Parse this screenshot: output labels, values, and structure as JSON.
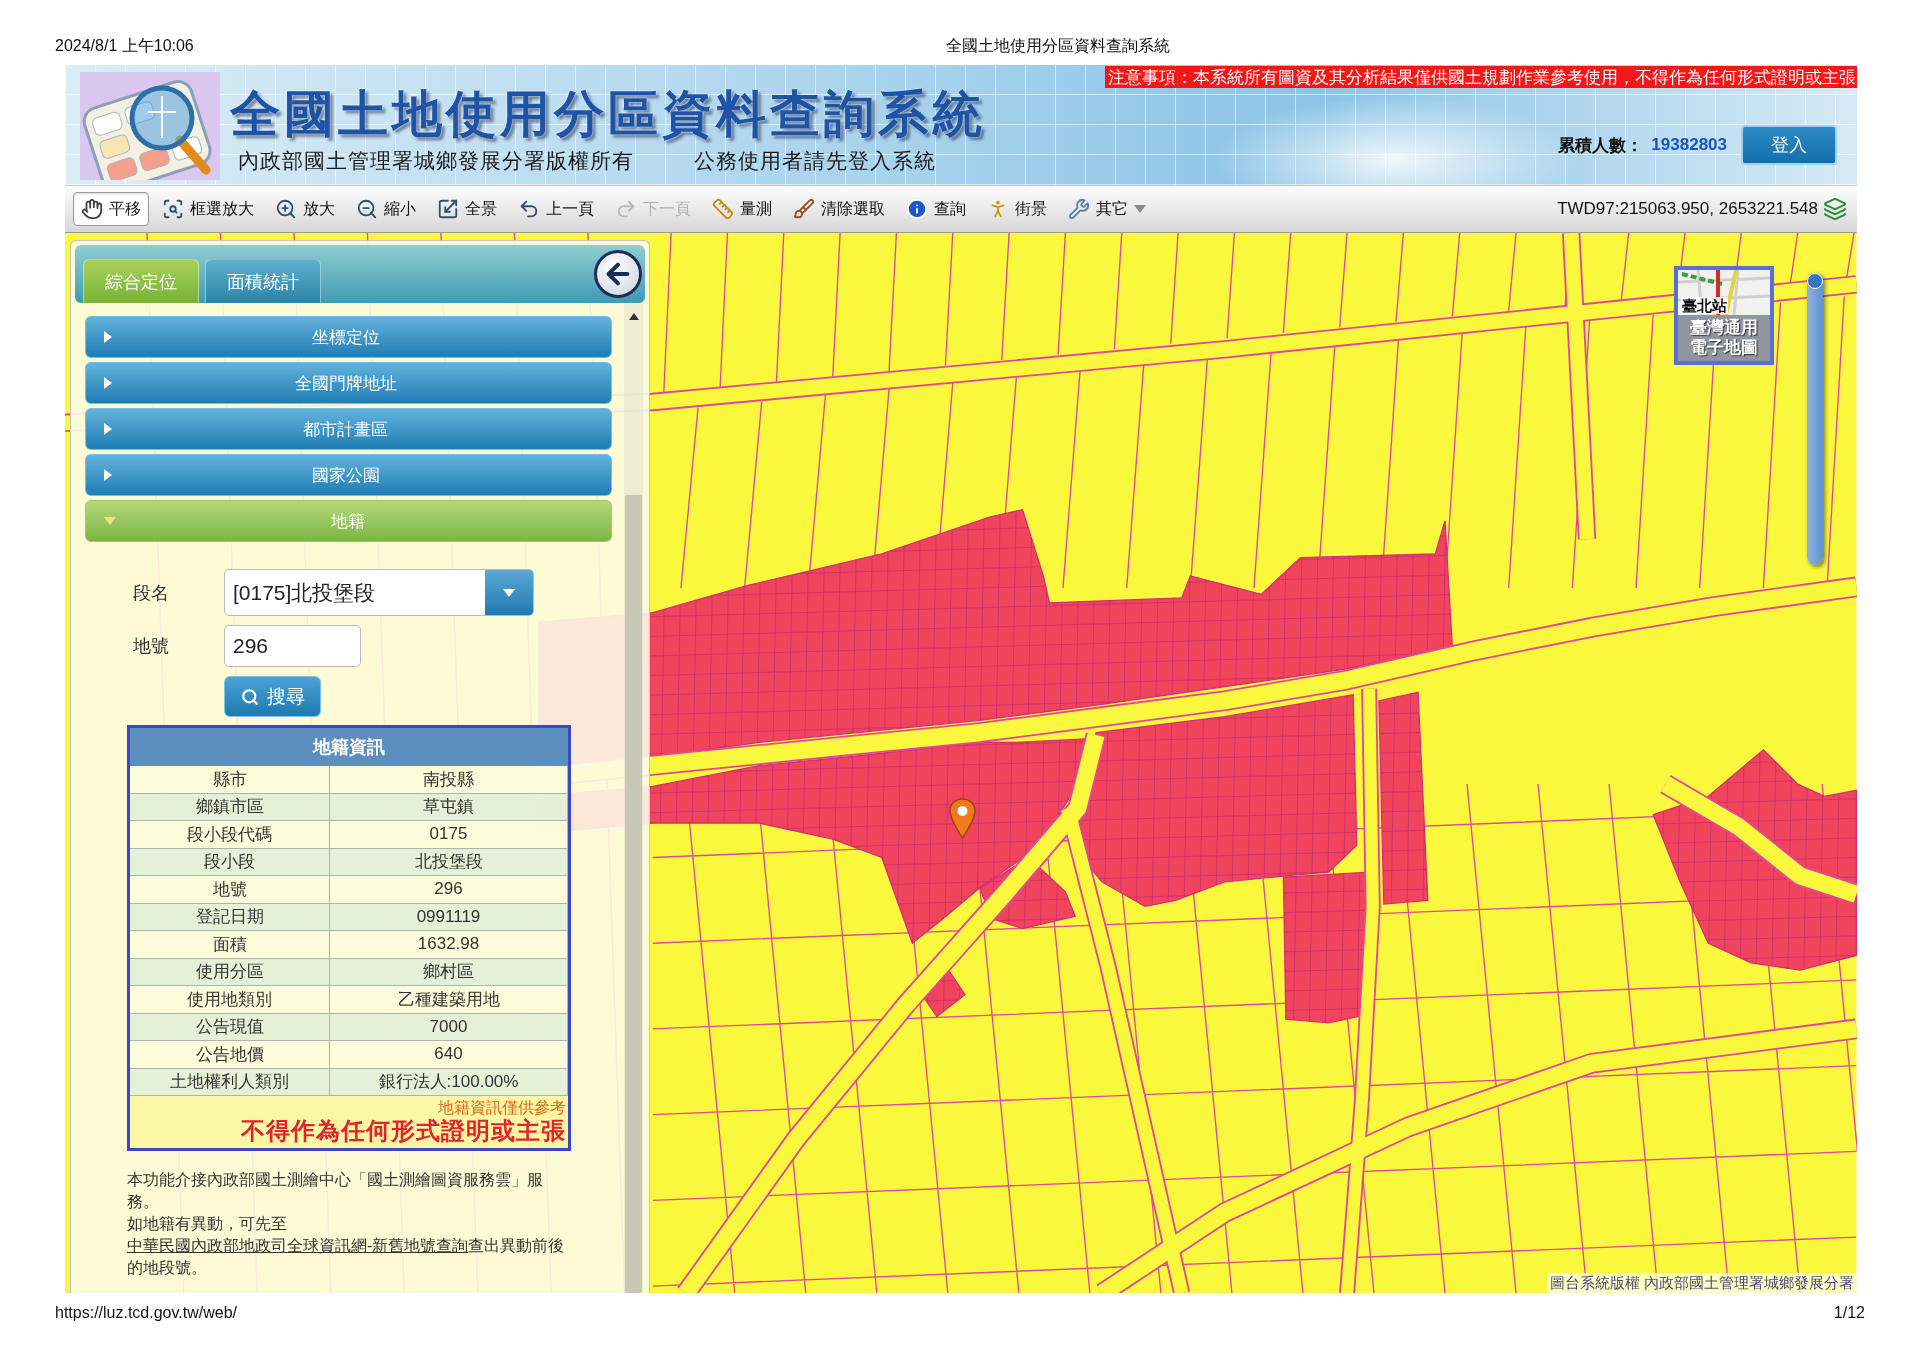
{
  "print_header": {
    "datetime": "2024/8/1 上午10:06",
    "title": "全國土地使用分區資料查詢系統"
  },
  "banner": {
    "title": "全國土地使用分區資料查詢系統",
    "copyright": "內政部國土管理署城鄉發展分署版權所有",
    "login_hint": "公務使用者請先登入系統",
    "notice": "注意事項：本系統所有圖資及其分析結果僅供國土規劃作業參考使用，不得作為任何形式證明或主張",
    "visitor_label": "累積人數：",
    "visitor_count": "19382803",
    "login_button": "登入"
  },
  "toolbar": {
    "tools": [
      {
        "label": "平移",
        "selected": true,
        "disabled": false,
        "kind": "tool"
      },
      {
        "label": "框選放大",
        "selected": false,
        "disabled": false,
        "kind": "tool"
      },
      {
        "label": "放大",
        "selected": false,
        "disabled": false,
        "kind": "tool"
      },
      {
        "label": "縮小",
        "selected": false,
        "disabled": false,
        "kind": "tool"
      },
      {
        "label": "全景",
        "selected": false,
        "disabled": false,
        "kind": "tool"
      },
      {
        "label": "上一頁",
        "selected": false,
        "disabled": false,
        "kind": "tool"
      },
      {
        "label": "下一頁",
        "selected": false,
        "disabled": true,
        "kind": "tool"
      },
      {
        "label": "量測",
        "selected": false,
        "disabled": false,
        "kind": "tool"
      },
      {
        "label": "清除選取",
        "selected": false,
        "disabled": false,
        "kind": "tool"
      },
      {
        "label": "查詢",
        "selected": false,
        "disabled": false,
        "kind": "tool"
      },
      {
        "label": "街景",
        "selected": false,
        "disabled": false,
        "kind": "tool"
      },
      {
        "label": "其它",
        "selected": false,
        "disabled": false,
        "kind": "menu"
      }
    ],
    "coordinates": "TWD97:215063.950, 2653221.548"
  },
  "side_panel": {
    "tabs": [
      {
        "label": "綜合定位",
        "selected": true
      },
      {
        "label": "面積統計",
        "selected": false
      }
    ],
    "sections": [
      {
        "label": "坐標定位",
        "expanded": false
      },
      {
        "label": "全國門牌地址",
        "expanded": false
      },
      {
        "label": "都市計畫區",
        "expanded": false
      },
      {
        "label": "國家公園",
        "expanded": false
      },
      {
        "label": "地籍",
        "expanded": true
      }
    ],
    "form": {
      "fields": [
        {
          "label": "段名",
          "kind": "select",
          "value": "[0175]北投堡段"
        },
        {
          "label": "地號",
          "kind": "input",
          "value": "296"
        }
      ],
      "search_button": "搜尋"
    },
    "info_table": {
      "title": "地籍資訊",
      "rows": [
        {
          "label": "縣市",
          "value": "南投縣"
        },
        {
          "label": "鄉鎮市區",
          "value": "草屯鎮"
        },
        {
          "label": "段小段代碼",
          "value": "0175"
        },
        {
          "label": "段小段",
          "value": "北投堡段"
        },
        {
          "label": "地號",
          "value": "296"
        },
        {
          "label": "登記日期",
          "value": "0991119"
        },
        {
          "label": "面積",
          "value": "1632.98"
        },
        {
          "label": "使用分區",
          "value": "鄉村區"
        },
        {
          "label": "使用地類別",
          "value": "乙種建築用地"
        },
        {
          "label": "公告現值",
          "value": "7000"
        },
        {
          "label": "公告地價",
          "value": "640"
        },
        {
          "label": "土地權利人類別",
          "value": "銀行法人:100.00%"
        }
      ],
      "note": "地籍資訊僅供參考",
      "warning": "不得作為任何形式證明或主張"
    },
    "description": [
      {
        "text": "本功能介接內政部國土測繪中心「國土測繪圖資服務雲」服務。"
      },
      {
        "text": "如地籍有異動，可先至",
        "link": "中華民國內政部地政司全球資訊網-新舊地號查詢",
        "after": "查出異動前後的地段號。"
      }
    ]
  },
  "map": {
    "basemap_switcher": {
      "place": "臺北站",
      "label": "臺灣通用電子地圖"
    },
    "zoom_slider": {
      "level": 1
    },
    "attribution": "圖台系統版權 內政部國土管理署城鄉發展分署"
  },
  "print_footer": {
    "url": "https://luz.tcd.gov.tw/web/",
    "page": "1/12"
  }
}
